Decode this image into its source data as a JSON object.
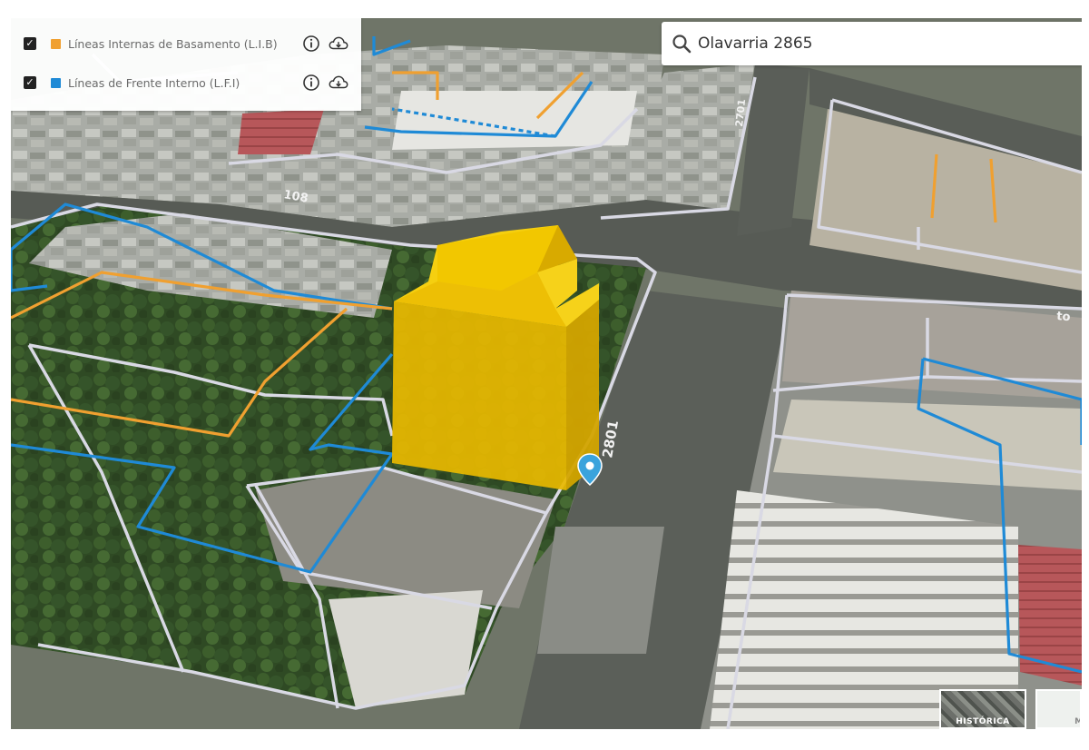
{
  "layers": [
    {
      "label": "Líneas Internas de Basamento (L.I.B)",
      "color": "#f0a030",
      "checked": true
    },
    {
      "label": "Líneas de Frente Interno (L.F.I)",
      "color": "#1f8ad6",
      "checked": true
    }
  ],
  "search": {
    "value": "Olavarria 2865"
  },
  "map_labels": {
    "street_num_1": "108",
    "street_num_2": "2801",
    "street_num_3": "2701",
    "street_num_4": "to"
  },
  "basemaps": {
    "historica_label": "HISTÓRICA",
    "mapa_label": "MA"
  },
  "colors": {
    "lib_line": "#f0a030",
    "lfi_line": "#1f8ad6",
    "parcel_line": "#d9d9e4",
    "building_volume": "#f2c200",
    "marker": "#3aa3dc"
  },
  "icons": {
    "checkbox": "check-icon",
    "info": "info-icon",
    "download": "cloud-download-icon",
    "search": "search-icon",
    "marker": "map-pin-icon"
  }
}
